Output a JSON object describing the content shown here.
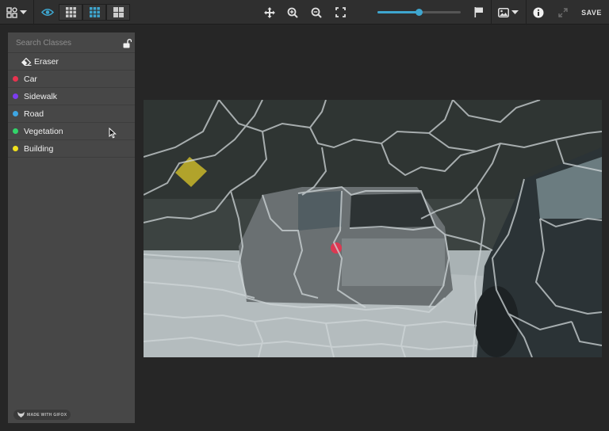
{
  "toolbar": {
    "save_label": "SAVE",
    "zoom_slider": {
      "value": 0.5
    },
    "icons": [
      "layout-icon",
      "eye-icon",
      "grid-small-icon",
      "grid-medium-icon",
      "grid-large-icon",
      "move-icon",
      "zoom-in-icon",
      "zoom-out-icon",
      "fullscreen-icon",
      "flag-icon",
      "image-icon",
      "info-icon",
      "expand-icon"
    ]
  },
  "panel": {
    "search_placeholder": "Search Classes",
    "eraser_label": "Eraser",
    "classes": [
      {
        "label": "Car",
        "color": "#e8334f"
      },
      {
        "label": "Sidewalk",
        "color": "#7c3cf0"
      },
      {
        "label": "Road",
        "color": "#3ea6e3"
      },
      {
        "label": "Vegetation",
        "color": "#32d46a"
      },
      {
        "label": "Building",
        "color": "#f1e11d"
      }
    ],
    "watermark": "MADE WITH GIFOX"
  },
  "colors": {
    "accent": "#3ea6cf",
    "panel": "#474747",
    "toolbar": "#2f2f2f"
  }
}
